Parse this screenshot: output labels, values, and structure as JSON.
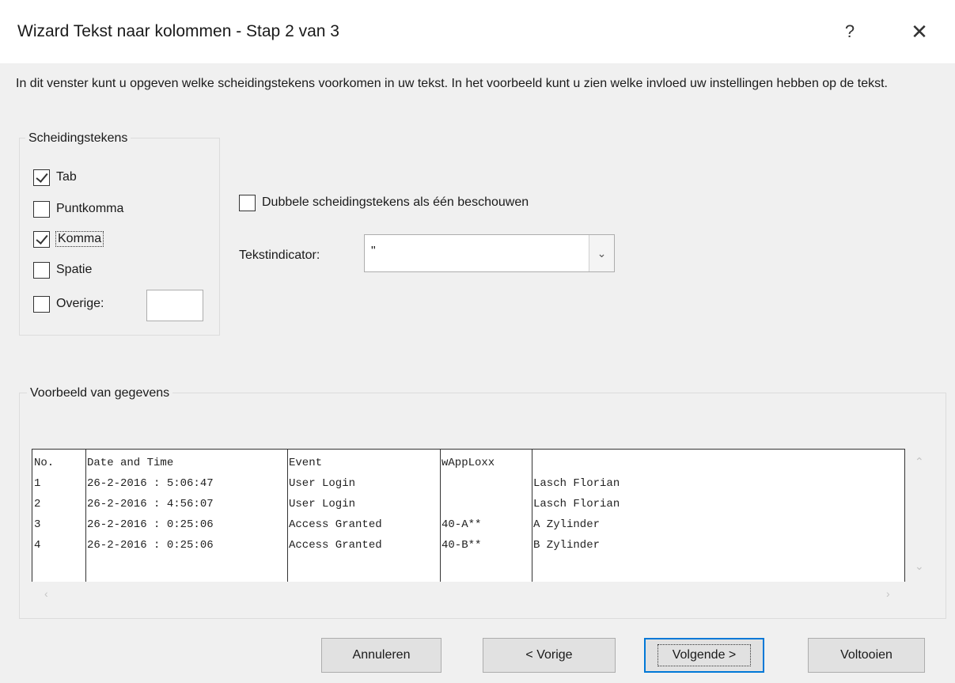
{
  "dialog": {
    "title": "Wizard Tekst naar kolommen - Stap 2 van 3",
    "help_label": "?",
    "close_label": "✕"
  },
  "description": "In dit venster kunt u opgeven welke scheidingstekens voorkomen in uw tekst. In het voorbeeld kunt u zien welke invloed uw instellingen hebben op de tekst.",
  "delimiters": {
    "legend": "Scheidingstekens",
    "items": [
      {
        "label": "Tab",
        "checked": true
      },
      {
        "label": "Puntkomma",
        "checked": false
      },
      {
        "label": "Komma",
        "checked": true
      },
      {
        "label": "Spatie",
        "checked": false
      },
      {
        "label": "Overige:",
        "checked": false
      }
    ],
    "other_value": ""
  },
  "treat_consecutive": {
    "label": "Dubbele scheidingstekens als één beschouwen",
    "checked": false
  },
  "text_qualifier": {
    "label": "Tekstindicator:",
    "value": "\""
  },
  "preview": {
    "legend": "Voorbeeld van gegevens",
    "rows": [
      [
        "No.",
        "Date and Time",
        "Event",
        "wAppLoxx",
        ""
      ],
      [
        "1",
        "26-2-2016 : 5:06:47",
        "User Login",
        "",
        "Lasch Florian"
      ],
      [
        "2",
        "26-2-2016 : 4:56:07",
        "User Login",
        "",
        "Lasch Florian"
      ],
      [
        "3",
        "26-2-2016 : 0:25:06",
        "Access Granted",
        "40-A**",
        "A Zylinder"
      ],
      [
        "4",
        "26-2-2016 : 0:25:06",
        "Access Granted",
        "40-B**",
        "B Zylinder"
      ]
    ]
  },
  "buttons": {
    "cancel": "Annuleren",
    "back": "< Vorige",
    "next": "Volgende >",
    "finish": "Voltooien"
  },
  "colors": {
    "accent": "#0078d7",
    "background": "#f0f0f0"
  }
}
